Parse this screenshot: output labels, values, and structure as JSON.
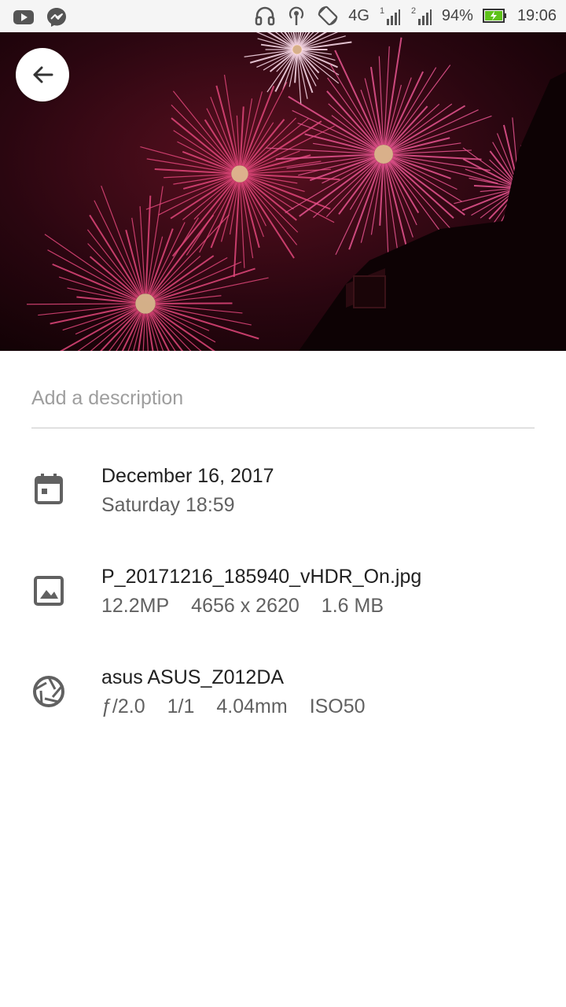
{
  "status_bar": {
    "network_label": "4G",
    "sim1_label": "1",
    "sim2_label": "2",
    "battery_percent": "94%",
    "time": "19:06",
    "left_icons": [
      "youtube-icon",
      "messenger-icon"
    ],
    "right_icons": [
      "headset-icon",
      "hotspot-icon",
      "rotate-icon",
      "signal-icon",
      "battery-charging-icon"
    ]
  },
  "photo": {
    "description": "fireworks photo",
    "back_icon": "arrow-back-icon"
  },
  "description_field": {
    "placeholder": "Add a description",
    "value": ""
  },
  "date_info": {
    "icon": "calendar-icon",
    "primary": "December 16, 2017",
    "secondary": "Saturday 18:59"
  },
  "file_info": {
    "icon": "image-icon",
    "primary": "P_20171216_185940_vHDR_On.jpg",
    "megapixels": "12.2MP",
    "resolution": "4656 x 2620",
    "size": "1.6 MB"
  },
  "camera_info": {
    "icon": "aperture-icon",
    "primary": "asus ASUS_Z012DA",
    "aperture": "ƒ/2.0",
    "exposure": "1/1",
    "focal_length": "4.04mm",
    "iso": "ISO50"
  },
  "colors": {
    "accent_firework": "#e0467a",
    "background": "#ffffff",
    "divider": "#e0e0e0",
    "secondary_text": "#616161"
  }
}
